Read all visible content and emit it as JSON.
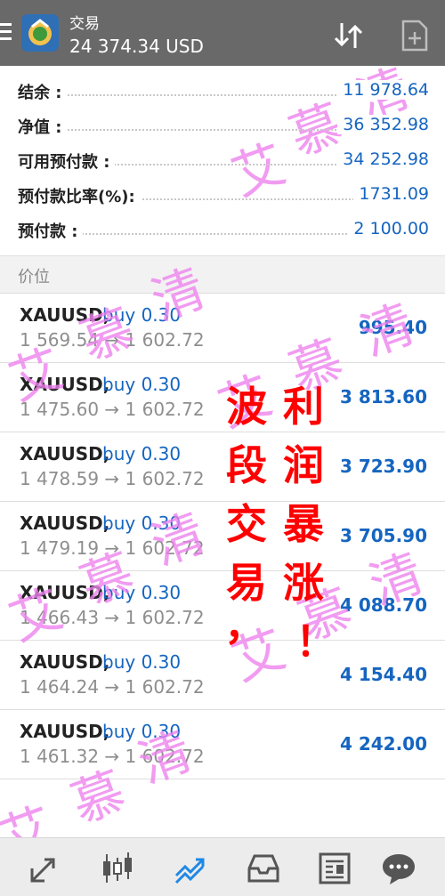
{
  "header": {
    "title": "交易",
    "balance_line": "24 374.34 USD"
  },
  "summary": [
    {
      "label": "结余 :",
      "value": "11 978.64"
    },
    {
      "label": "净值 :",
      "value": "36 352.98"
    },
    {
      "label": "可用预付款 :",
      "value": "34 252.98"
    },
    {
      "label": "预付款比率(%):",
      "value": "1731.09"
    },
    {
      "label": "预付款 :",
      "value": "2 100.00"
    }
  ],
  "section_title": "价位",
  "positions": [
    {
      "symbol": "XAUUSD,",
      "type": "buy 0.30",
      "prices": "1 569.54 → 1 602.72",
      "profit": "995.40"
    },
    {
      "symbol": "XAUUSD,",
      "type": "buy 0.30",
      "prices": "1 475.60 → 1 602.72",
      "profit": "3 813.60"
    },
    {
      "symbol": "XAUUSD,",
      "type": "buy 0.30",
      "prices": "1 478.59 → 1 602.72",
      "profit": "3 723.90"
    },
    {
      "symbol": "XAUUSD,",
      "type": "buy 0.30",
      "prices": "1 479.19 → 1 602.72",
      "profit": "3 705.90"
    },
    {
      "symbol": "XAUUSD,",
      "type": "buy 0.30",
      "prices": "1 466.43 → 1 602.72",
      "profit": "4 088.70"
    },
    {
      "symbol": "XAUUSD,",
      "type": "buy 0.30",
      "prices": "1 464.24 → 1 602.72",
      "profit": "4 154.40"
    },
    {
      "symbol": "XAUUSD,",
      "type": "buy 0.30",
      "prices": "1 461.32 → 1 602.72",
      "profit": "4 242.00"
    }
  ],
  "overlay": {
    "left_column": [
      "波",
      "段",
      "交",
      "易",
      "，"
    ],
    "right_column": [
      "利",
      "润",
      "暴",
      "涨",
      "！"
    ],
    "watermark": [
      "艾",
      "慕",
      "清"
    ]
  },
  "icons": {
    "menu": "hamburger-icon",
    "logo": "metatrader-logo",
    "sort": "sort-arrows-icon",
    "new_order": "new-order-icon",
    "nav": [
      "quotes-icon",
      "chart-icon",
      "trade-icon",
      "history-icon",
      "news-icon",
      "chat-icon"
    ]
  },
  "colors": {
    "topbar": "#696969",
    "accent": "#1565c0",
    "overlay_red": "#ff0000",
    "watermark": "#ee82ee"
  }
}
